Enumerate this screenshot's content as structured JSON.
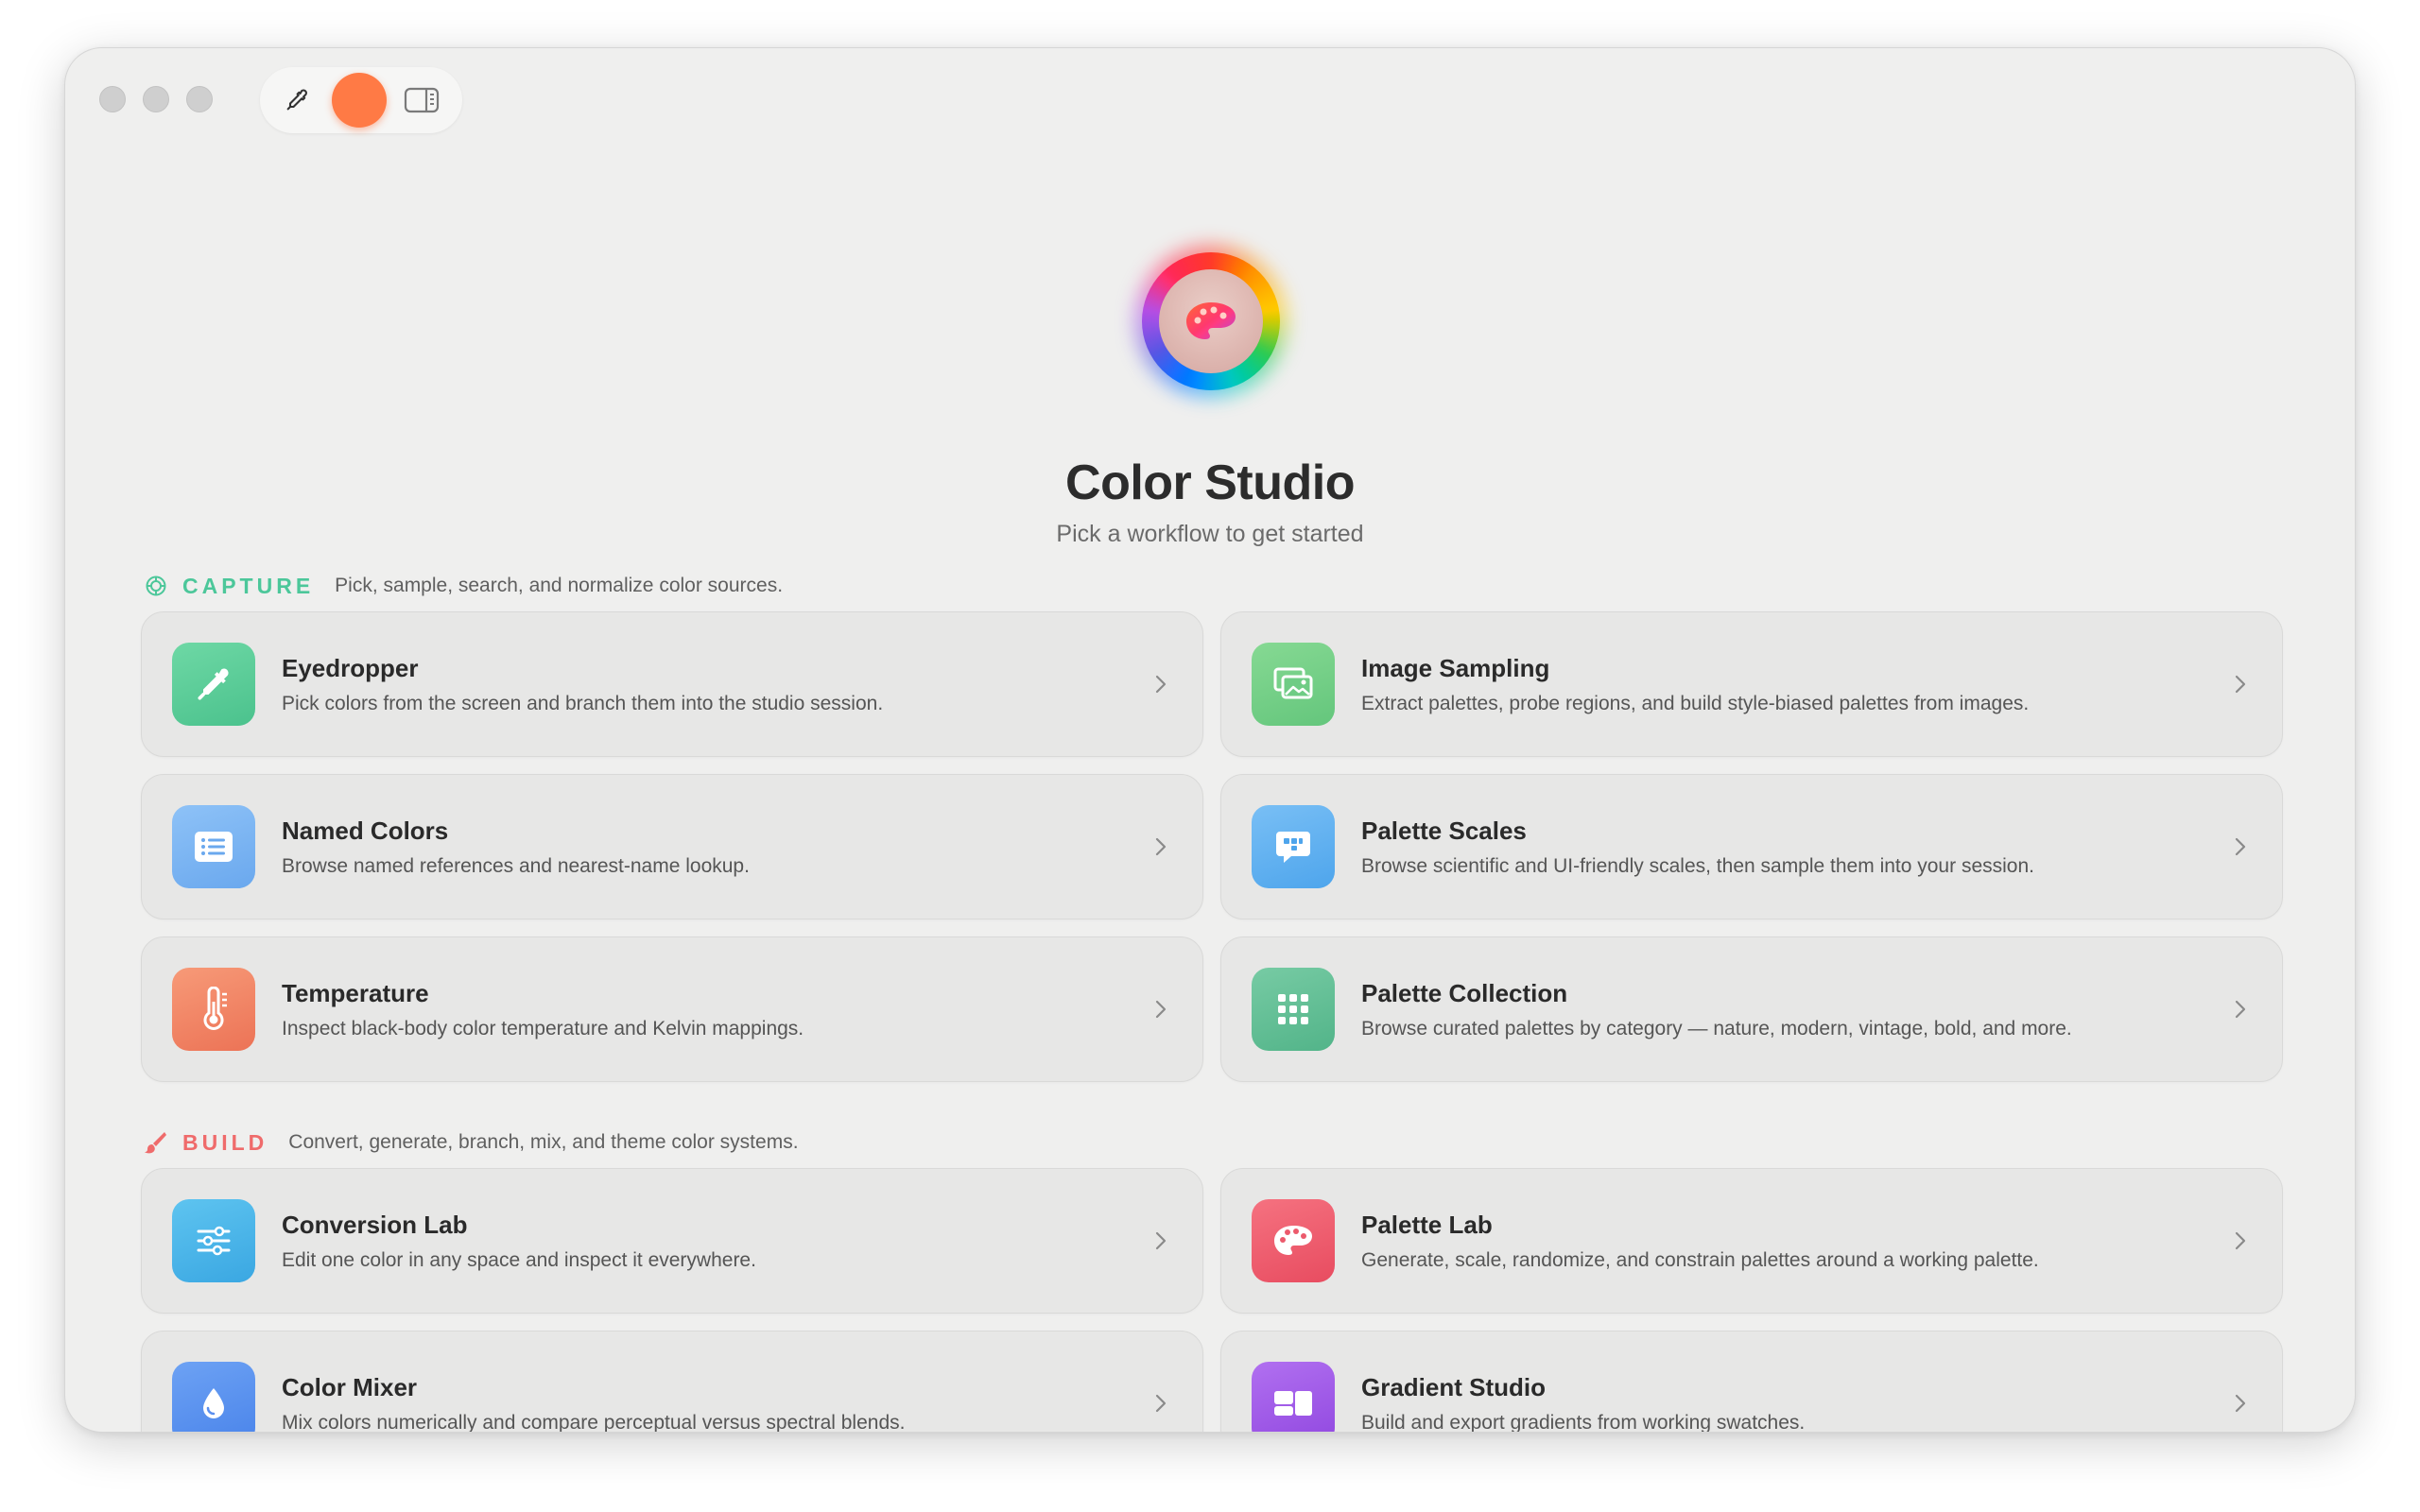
{
  "app": {
    "title": "Color Studio",
    "subtitle": "Pick a workflow to get started",
    "current_color": "#ff7a45"
  },
  "toolbar": {
    "eyedropper_icon": "eyedropper-icon",
    "sidebar_icon": "sidebar-toggle-icon"
  },
  "sections": [
    {
      "title": "CAPTURE",
      "description": "Pick, sample, search, and normalize color sources.",
      "color": "#4cc79a",
      "icon": "capture-target-icon",
      "items": [
        {
          "title": "Eyedropper",
          "description": "Pick colors from the screen and branch them into the studio session.",
          "icon": "eyedropper-icon",
          "color": "#5fcf9b"
        },
        {
          "title": "Image Sampling",
          "description": "Extract palettes, probe regions, and build style-biased palettes from images.",
          "icon": "image-stack-icon",
          "color": "#77d088"
        },
        {
          "title": "Named Colors",
          "description": "Browse named references and nearest-name lookup.",
          "icon": "list-icon",
          "color": "#7bb4f2"
        },
        {
          "title": "Palette Scales",
          "description": "Browse scientific and UI-friendly scales, then sample them into your session.",
          "icon": "swatch-chat-icon",
          "color": "#5fb0f0"
        },
        {
          "title": "Temperature",
          "description": "Inspect black-body color temperature and Kelvin mappings.",
          "icon": "thermometer-icon",
          "color": "#f2876a"
        },
        {
          "title": "Palette Collection",
          "description": "Browse curated palettes by category — nature, modern, vintage, bold, and more.",
          "icon": "grid-icon",
          "color": "#63c09a"
        }
      ]
    },
    {
      "title": "BUILD",
      "description": "Convert, generate, branch, mix, and theme color systems.",
      "color": "#ef6b6b",
      "icon": "paintbrush-icon",
      "items": [
        {
          "title": "Conversion Lab",
          "description": "Edit one color in any space and inspect it everywhere.",
          "icon": "sliders-icon",
          "color": "#45b5e8"
        },
        {
          "title": "Palette Lab",
          "description": "Generate, scale, randomize, and constrain palettes around a working palette.",
          "icon": "palette-icon",
          "color": "#ef5f6e"
        },
        {
          "title": "Color Mixer",
          "description": "Mix colors numerically and compare perceptual versus spectral blends.",
          "icon": "drop-icon",
          "color": "#5b8fef"
        },
        {
          "title": "Gradient Studio",
          "description": "Build and export gradients from working swatches.",
          "icon": "gradient-blocks-icon",
          "color": "#a25ae8"
        }
      ]
    }
  ]
}
